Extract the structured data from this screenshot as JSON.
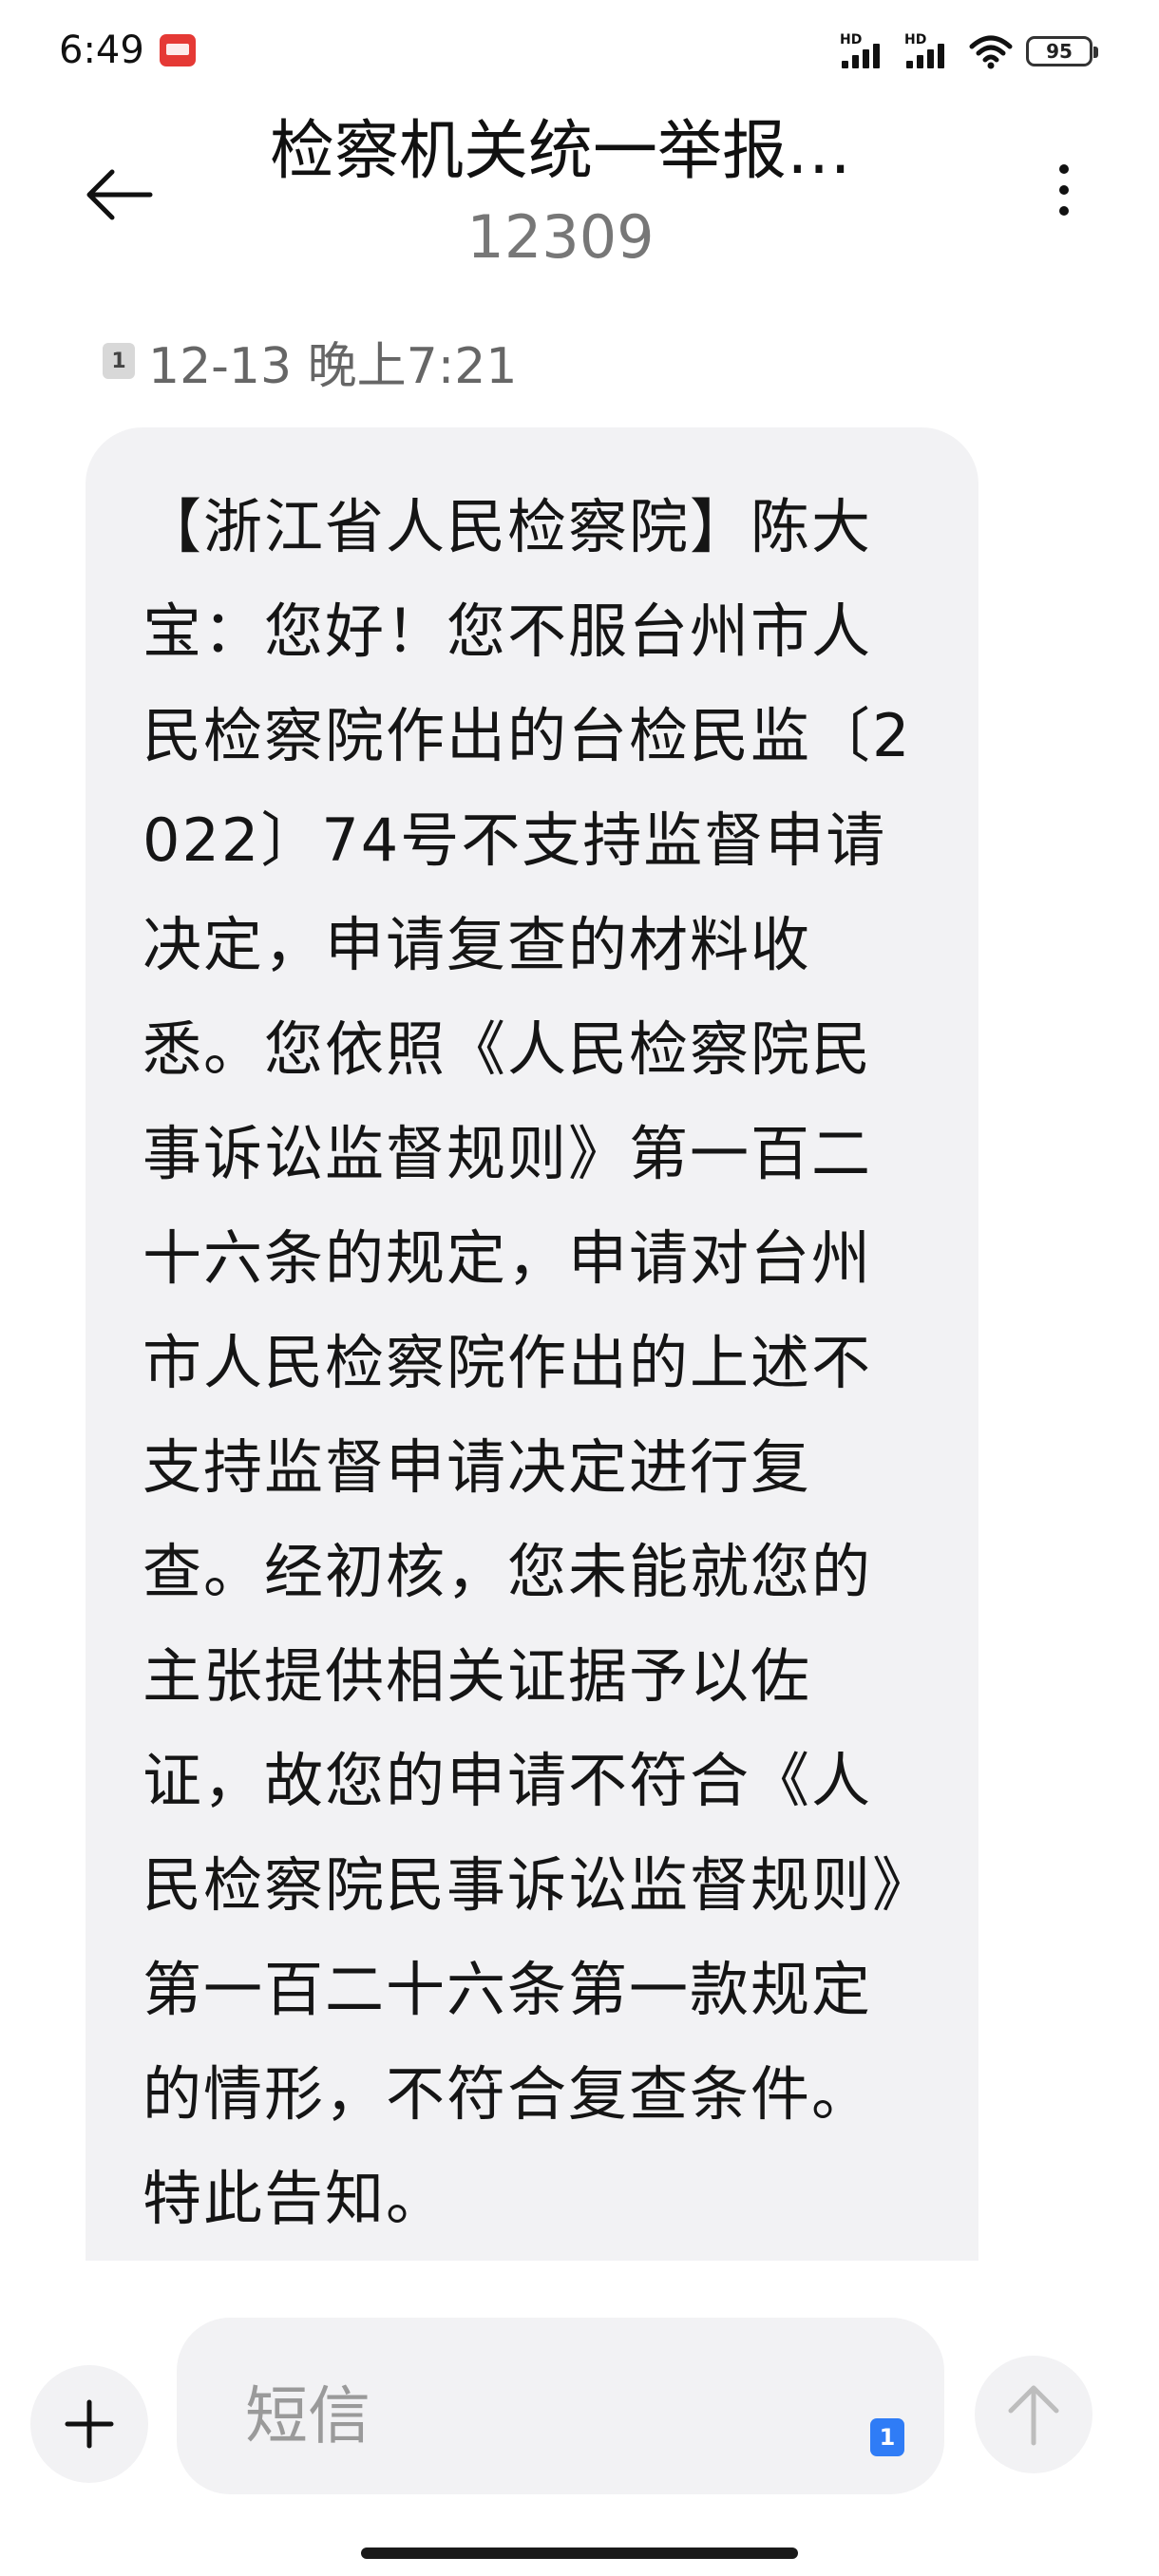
{
  "status_bar": {
    "time": "6:49",
    "app_icon": "news-app-icon",
    "signal1_label": "HD",
    "signal2_label": "HD",
    "wifi_icon": "wifi-icon",
    "battery_level": "95"
  },
  "header": {
    "back_icon": "back-arrow-icon",
    "title": "检察机关统一举报…",
    "number": "12309",
    "more_icon": "more-vertical-icon"
  },
  "message": {
    "sim_slot": "1",
    "timestamp": "12-13 晚上7:21",
    "text": "【浙江省人民检察院】陈大宝：您好！您不服台州市人民检察院作出的台检民监〔2022〕74号不支持监督申请决定，申请复查的材料收悉。您依照《人民检察院民事诉讼监督规则》第一百二十六条的规定，申请对台州市人民检察院作出的上述不支持监督申请决定进行复查。经初核，您未能就您的主张提供相关证据予以佐证，故您的申请不符合《人民检察院民事诉讼监督规则》第一百二十六条第一款规定的情形，不符合复查条件。特此告知。"
  },
  "composer": {
    "add_icon": "plus-icon",
    "placeholder": "短信",
    "sim_slot": "1",
    "send_icon": "send-arrow-up-icon"
  },
  "colors": {
    "bubble_bg": "#f2f2f4",
    "sim_badge_active": "#2f7cf6",
    "secondary_text": "#777777"
  }
}
